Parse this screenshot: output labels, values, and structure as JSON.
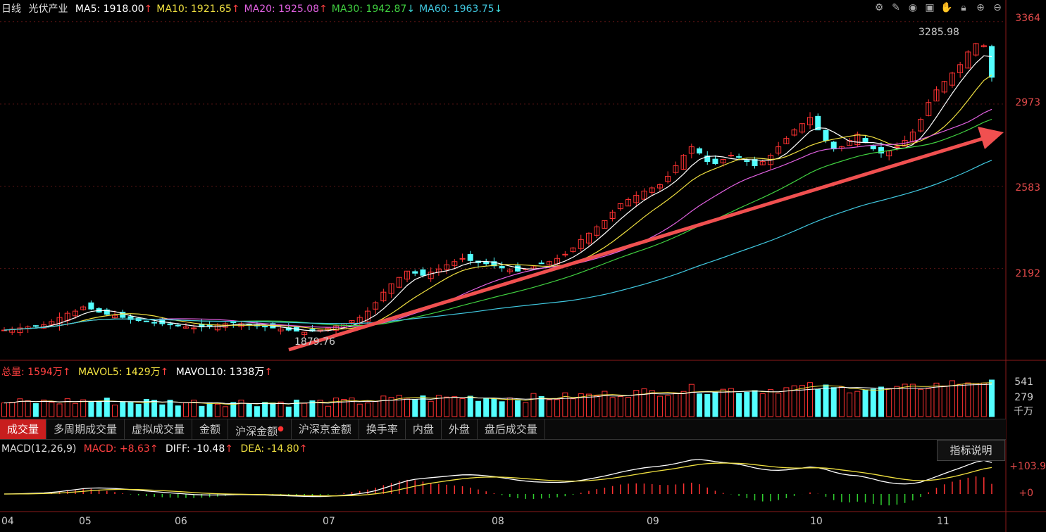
{
  "header": {
    "period": "日线",
    "name": "光伏产业",
    "ma": [
      {
        "label": "MA5: 1918.00",
        "arrow": "↑",
        "color": "#ffffff"
      },
      {
        "label": "MA10: 1921.65",
        "arrow": "↑",
        "color": "#f0e040"
      },
      {
        "label": "MA20: 1925.08",
        "arrow": "↑",
        "color": "#e060e0"
      },
      {
        "label": "MA30: 1942.87",
        "arrow": "↓",
        "color": "#40d040"
      },
      {
        "label": "MA60: 1963.75",
        "arrow": "↓",
        "color": "#40c8e0"
      }
    ]
  },
  "toolbar_icons": [
    "gear-icon",
    "brush-icon",
    "eye-icon",
    "box-icon",
    "hand-icon",
    "lock-icon",
    "zoom-in-icon",
    "zoom-out-icon"
  ],
  "volume_header": {
    "total": "总量: 1594万",
    "mavol5": "MAVOL5: 1429万",
    "mavol10": "MAVOL10: 1338万",
    "arrow": "↑"
  },
  "tabs": [
    "成交量",
    "多周期成交量",
    "虚拟成交量",
    "金额",
    "沪深金额",
    "沪深京金额",
    "换手率",
    "内盘",
    "外盘",
    "盘后成交量"
  ],
  "macd_header": {
    "name": "MACD(12,26,9)",
    "macd": "MACD: +8.63",
    "diff": "DIFF: -10.48",
    "dea": "DEA: -14.80",
    "arrow": "↑"
  },
  "explain_button": "指标说明",
  "price_axis": [
    "3364",
    "2973",
    "2583",
    "2192"
  ],
  "volume_axis": [
    "541",
    "279",
    "千万"
  ],
  "macd_axis": [
    "+103.9",
    "+0"
  ],
  "months": [
    "04",
    "05",
    "06",
    "07",
    "08",
    "09",
    "10",
    "11"
  ],
  "annotations": {
    "high": "3285.98",
    "low": "1879.76"
  },
  "colors": {
    "up": "#ff3232",
    "down": "#54ffff",
    "ma5": "#ffffff",
    "ma10": "#f0e040",
    "ma20": "#e060e0",
    "ma30": "#40d040",
    "ma60": "#40c8e0",
    "trend_arrow": "#f05050"
  },
  "chart_data": {
    "type": "candlestick",
    "ylim": [
      1780,
      3400
    ],
    "closes": [
      1900,
      1905,
      1910,
      1915,
      1920,
      1925,
      1940,
      1960,
      1980,
      1990,
      2010,
      2000,
      1985,
      1975,
      1970,
      1960,
      1950,
      1945,
      1940,
      1935,
      1930,
      1925,
      1920,
      1915,
      1910,
      1915,
      1920,
      1925,
      1930,
      1935,
      1930,
      1925,
      1920,
      1915,
      1910,
      1905,
      1900,
      1895,
      1890,
      1895,
      1900,
      1910,
      1920,
      1930,
      1945,
      1960,
      1990,
      2030,
      2080,
      2120,
      2150,
      2180,
      2170,
      2160,
      2175,
      2190,
      2210,
      2225,
      2240,
      2230,
      2220,
      2215,
      2205,
      2195,
      2185,
      2180,
      2190,
      2200,
      2215,
      2225,
      2240,
      2260,
      2290,
      2330,
      2360,
      2390,
      2420,
      2460,
      2500,
      2520,
      2540,
      2560,
      2575,
      2590,
      2630,
      2680,
      2730,
      2770,
      2740,
      2700,
      2690,
      2710,
      2730,
      2720,
      2700,
      2680,
      2700,
      2730,
      2770,
      2810,
      2850,
      2880,
      2910,
      2850,
      2800,
      2760,
      2770,
      2800,
      2830,
      2790,
      2760,
      2740,
      2750,
      2770,
      2800,
      2840,
      2900,
      2980,
      3040,
      3080,
      3120,
      3160,
      3220,
      3260,
      3250,
      3100
    ],
    "ma5_end": 3150,
    "ma10_end": 3060,
    "ma20_end": 2930,
    "ma30_end": 2850,
    "ma60_end": 2680
  }
}
